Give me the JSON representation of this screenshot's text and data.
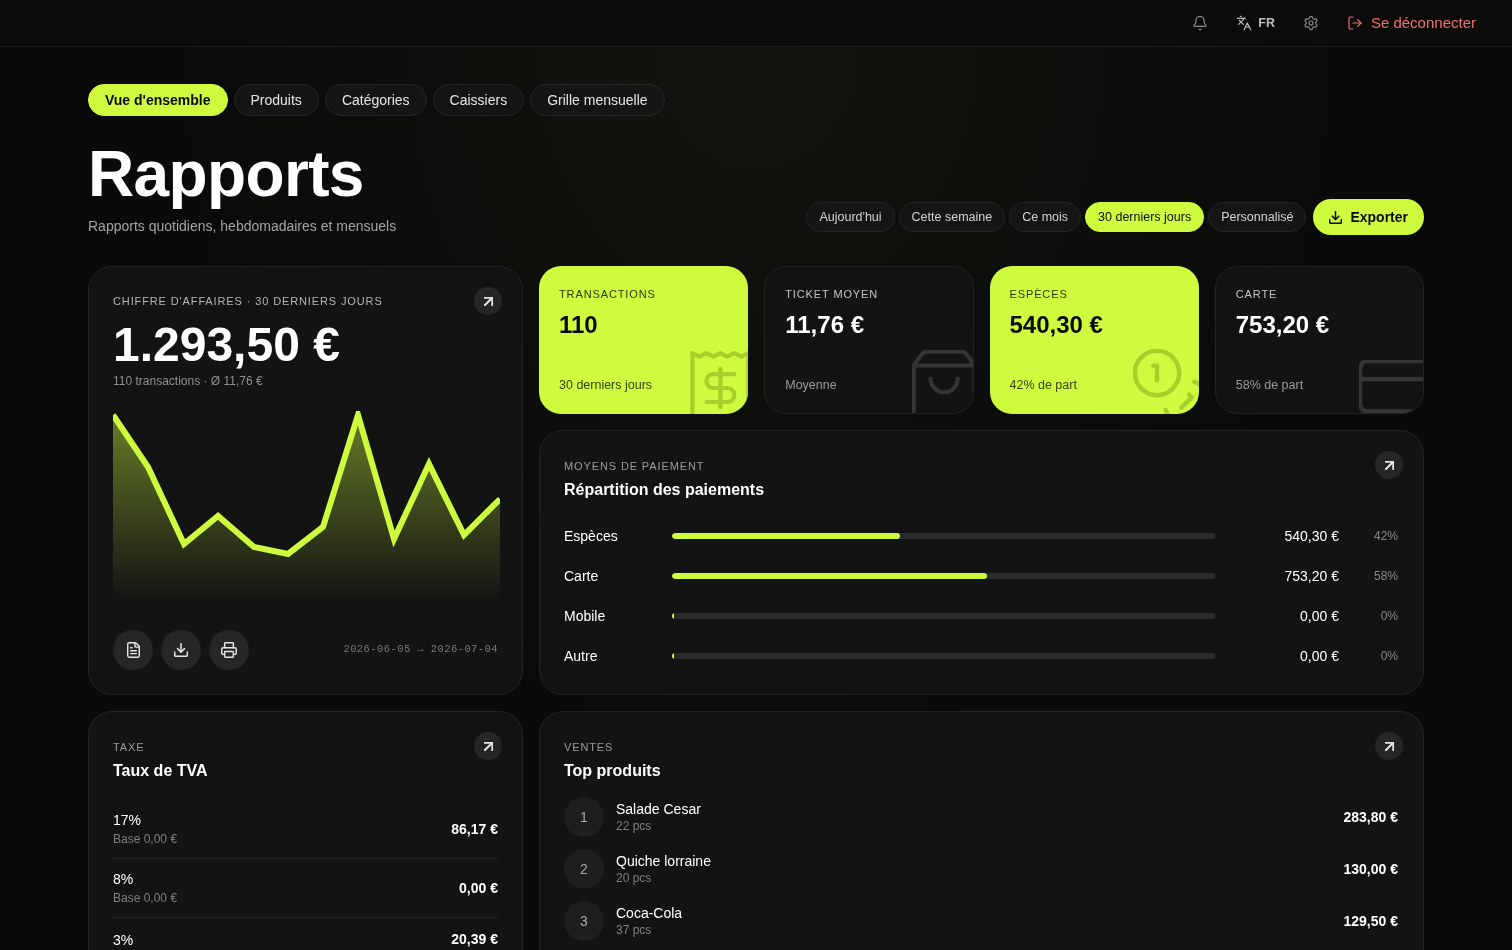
{
  "header": {
    "language": "FR",
    "logout": "Se déconnecter"
  },
  "tabs": [
    {
      "label": "Vue d'ensemble",
      "selected": true
    },
    {
      "label": "Produits",
      "selected": false
    },
    {
      "label": "Catégories",
      "selected": false
    },
    {
      "label": "Caissiers",
      "selected": false
    },
    {
      "label": "Grille mensuelle",
      "selected": false
    }
  ],
  "page": {
    "title": "Rapports",
    "subtitle": "Rapports quotidiens, hebdomadaires et mensuels"
  },
  "periods": [
    {
      "label": "Aujourd'hui",
      "selected": false
    },
    {
      "label": "Cette semaine",
      "selected": false
    },
    {
      "label": "Ce mois",
      "selected": false
    },
    {
      "label": "30 derniers jours",
      "selected": true
    },
    {
      "label": "Personnalisé",
      "selected": false
    }
  ],
  "export_button": "Exporter",
  "revenue_card": {
    "label": "CHIFFRE D'AFFAIRES · 30 DERNIERS JOURS",
    "total": "1.293,50 €",
    "summary": "110 transactions · Ø 11,76 €",
    "date_range": "2026-06-05 → 2026-07-04"
  },
  "stat_cards": [
    {
      "kind": "receipt",
      "label": "TRANSACTIONS",
      "value": "110",
      "note": "30 derniers jours",
      "highlighted": true
    },
    {
      "kind": "bag",
      "label": "TICKET MOYEN",
      "value": "11,76 €",
      "note": "Moyenne",
      "highlighted": false
    },
    {
      "kind": "coins",
      "label": "ESPÈCES",
      "value": "540,30 €",
      "note": "42% de part",
      "highlighted": true
    },
    {
      "kind": "card",
      "label": "CARTE",
      "value": "753,20 €",
      "note": "58% de part",
      "highlighted": false
    }
  ],
  "payments": {
    "label": "MOYENS DE PAIEMENT",
    "title": "Répartition des paiements",
    "rows": [
      {
        "method": "Espèces",
        "level": 0.42,
        "amount": "540,30 €",
        "share": "42%"
      },
      {
        "method": "Carte",
        "level": 0.58,
        "amount": "753,20 €",
        "share": "58%"
      },
      {
        "method": "Mobile",
        "level": 0,
        "amount": "0,00 €",
        "share": "0%"
      },
      {
        "method": "Autre",
        "level": 0,
        "amount": "0,00 €",
        "share": "0%"
      }
    ]
  },
  "vat": {
    "label": "TAXE",
    "title": "Taux de TVA",
    "rows": [
      {
        "rate": "17%",
        "base": "Base 0,00 €",
        "amount": "86,17 €"
      },
      {
        "rate": "8%",
        "base": "Base 0,00 €",
        "amount": "0,00 €"
      },
      {
        "rate": "3%",
        "amount": "20,39 €"
      }
    ]
  },
  "top_products": {
    "label": "VENTES",
    "title": "Top produits",
    "rows": [
      {
        "rank": "1",
        "name": "Salade Cesar",
        "qty": "22 pcs",
        "amount": "283,80 €"
      },
      {
        "rank": "2",
        "name": "Quiche lorraine",
        "qty": "20 pcs",
        "amount": "130,00 €"
      },
      {
        "rank": "3",
        "name": "Coca-Cola",
        "qty": "37 pcs",
        "amount": "129,50 €"
      }
    ]
  }
}
